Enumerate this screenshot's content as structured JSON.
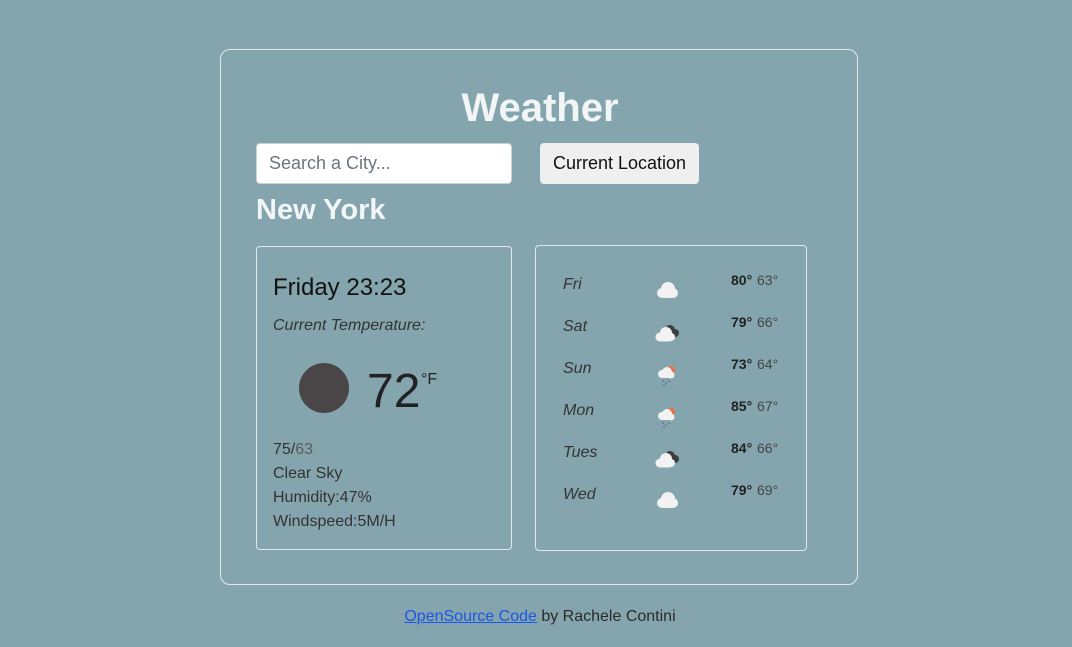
{
  "app": {
    "title": "Weather"
  },
  "search": {
    "placeholder": "Search a City...",
    "value": ""
  },
  "location_button": {
    "label": "Current Location"
  },
  "city": "New York",
  "current": {
    "datetime": "Friday 23:23",
    "label": "Current Temperature:",
    "icon": "sun-icon",
    "temperature": "72",
    "unit": "°F",
    "high": "75",
    "separator": "/",
    "low": "63",
    "description": "Clear Sky",
    "humidity": "Humidity:47%",
    "windspeed": "Windspeed:5M/H"
  },
  "forecast": [
    {
      "day": "Fri",
      "icon": "cloud-icon",
      "high": "80°",
      "low": "63°"
    },
    {
      "day": "Sat",
      "icon": "broken-clouds-icon",
      "high": "79°",
      "low": "66°"
    },
    {
      "day": "Sun",
      "icon": "rain-sun-icon",
      "high": "73°",
      "low": "64°"
    },
    {
      "day": "Mon",
      "icon": "rain-sun-icon",
      "high": "85°",
      "low": "67°"
    },
    {
      "day": "Tues",
      "icon": "broken-clouds-icon",
      "high": "84°",
      "low": "66°"
    },
    {
      "day": "Wed",
      "icon": "cloud-icon",
      "high": "79°",
      "low": "69°"
    }
  ],
  "footer": {
    "link_text": "OpenSource Code",
    "text": " by Rachele Contini"
  },
  "colors": {
    "background": "#85a5ae",
    "link": "#1a55e8",
    "title": "#f1f5f6"
  }
}
